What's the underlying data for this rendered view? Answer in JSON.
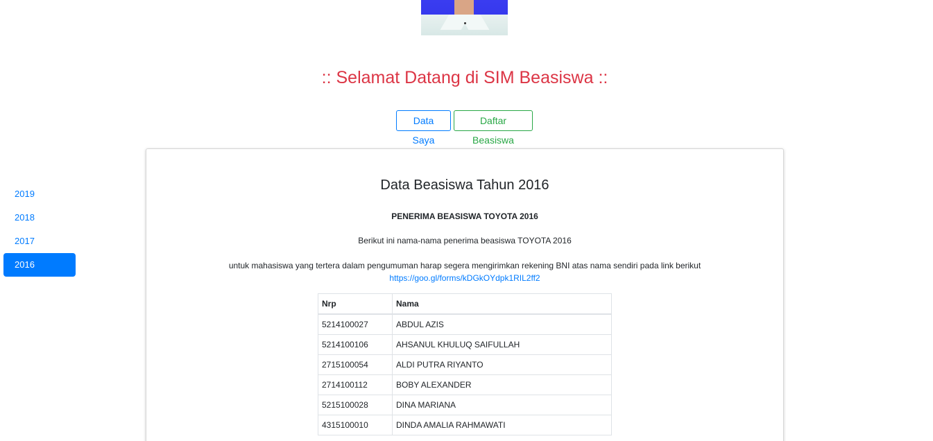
{
  "header": {
    "welcome": ":: Selamat Datang di SIM Beasiswa ::",
    "buttons": {
      "data_saya": "Data Saya",
      "daftar_beasiswa": "Daftar Beasiswa"
    }
  },
  "sidebar": {
    "items": [
      {
        "label": "2019",
        "active": false
      },
      {
        "label": "2018",
        "active": false
      },
      {
        "label": "2017",
        "active": false
      },
      {
        "label": "2016",
        "active": true
      }
    ]
  },
  "content": {
    "title": "Data Beasiswa Tahun 2016",
    "subtitle": "PENERIMA BEASISWA TOYOTA 2016",
    "intro": "Berikut ini nama-nama penerima beasiswa TOYOTA 2016",
    "instruction": "untuk mahasiswa yang tertera dalam pengumuman harap segera mengirimkan rekening BNI atas nama sendiri pada link berikut",
    "link": "https://goo.gl/forms/kDGkOYdpk1RIL2ff2",
    "table": {
      "headers": [
        "Nrp",
        "Nama"
      ],
      "rows": [
        [
          "5214100027",
          "ABDUL AZIS"
        ],
        [
          "5214100106",
          "AHSANUL KHULUQ SAIFULLAH"
        ],
        [
          "2715100054",
          "ALDI PUTRA RIYANTO"
        ],
        [
          "2714100112",
          "BOBY ALEXANDER"
        ],
        [
          "5215100028",
          "DINA MARIANA"
        ],
        [
          "4315100010",
          "DINDA AMALIA RAHMAWATI"
        ]
      ]
    }
  },
  "colors": {
    "primary": "#007bff",
    "success": "#28a745",
    "danger": "#dc3545"
  }
}
